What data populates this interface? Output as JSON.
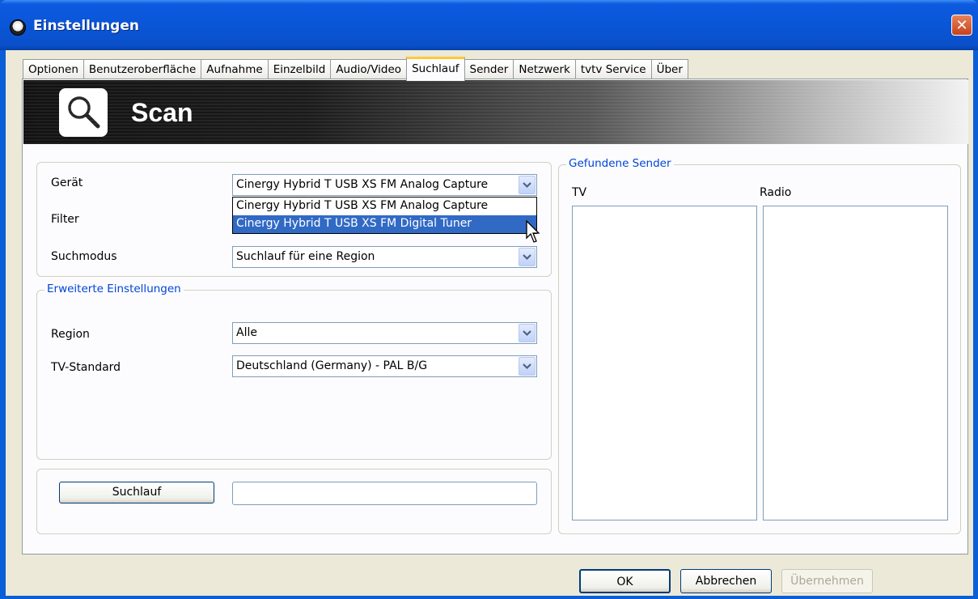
{
  "window": {
    "title": "Einstellungen"
  },
  "tabs": [
    {
      "label": "Optionen"
    },
    {
      "label": "Benutzeroberfläche"
    },
    {
      "label": "Aufnahme"
    },
    {
      "label": "Einzelbild"
    },
    {
      "label": "Audio/Video"
    },
    {
      "label": "Suchlauf",
      "active": true
    },
    {
      "label": "Sender"
    },
    {
      "label": "Netzwerk"
    },
    {
      "label": "tvtv Service"
    },
    {
      "label": "Über"
    }
  ],
  "banner": {
    "title": "Scan",
    "icon": "magnifier-icon"
  },
  "device_group": {
    "device_label": "Gerät",
    "device_value": "Cinergy Hybrid T USB XS FM Analog Capture",
    "device_options": [
      {
        "label": "Cinergy Hybrid T USB XS FM Analog Capture",
        "highlighted": false
      },
      {
        "label": "Cinergy Hybrid T USB XS FM Digital Tuner",
        "highlighted": true
      }
    ],
    "filter_label": "Filter",
    "mode_label": "Suchmodus",
    "mode_value": "Suchlauf für eine Region"
  },
  "advanced": {
    "legend": "Erweiterte Einstellungen",
    "region_label": "Region",
    "region_value": "Alle",
    "standard_label": "TV-Standard",
    "standard_value": "Deutschland (Germany) - PAL B/G"
  },
  "scan": {
    "button": "Suchlauf",
    "status": ""
  },
  "found": {
    "legend": "Gefundene Sender",
    "tv_label": "TV",
    "radio_label": "Radio"
  },
  "footer": {
    "ok": "OK",
    "cancel": "Abbrechen",
    "apply": "Übernehmen"
  },
  "colors": {
    "titlebar": "#0a56d8",
    "accent": "#0046d5",
    "selection": "#316ac5",
    "tab_highlight": "#ffc83c",
    "close": "#c8401c"
  }
}
